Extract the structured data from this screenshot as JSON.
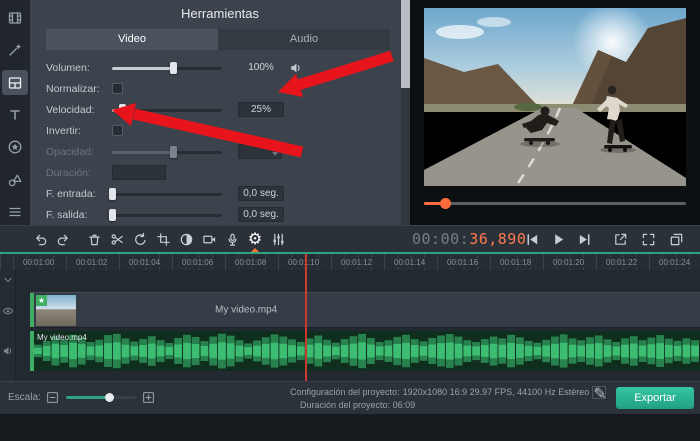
{
  "colors": {
    "accent_teal": "#2fbf9a",
    "accent_orange": "#ff7a45",
    "annotation_red": "#e8141b",
    "export_button": "#27b694",
    "playhead_red": "#c8392e"
  },
  "sidebar": {
    "items": [
      {
        "id": "media",
        "icon": "film-icon",
        "active": false
      },
      {
        "id": "filters",
        "icon": "wand-icon",
        "active": false
      },
      {
        "id": "tools",
        "icon": "panels-icon",
        "active": true
      },
      {
        "id": "titles",
        "icon": "titles-icon",
        "active": false
      },
      {
        "id": "stickers",
        "icon": "star-icon",
        "active": false
      },
      {
        "id": "callouts",
        "icon": "shapes-icon",
        "active": false
      },
      {
        "id": "more-tools",
        "icon": "list-icon",
        "active": false
      }
    ]
  },
  "tools_panel": {
    "title": "Herramientas",
    "tabs": [
      {
        "label": "Video",
        "active": true
      },
      {
        "label": "Audio",
        "active": false
      }
    ],
    "rows": [
      {
        "label": "Volumen:",
        "control": "slider",
        "fill": 55,
        "value": "100%",
        "boxed": false,
        "icon": "speaker-icon",
        "disabled": false
      },
      {
        "label": "Normalizar:",
        "control": "checkbox",
        "checked": false,
        "disabled": false
      },
      {
        "label": "Velocidad:",
        "control": "slider",
        "fill": 9,
        "value": "25%",
        "boxed": true,
        "disabled": false
      },
      {
        "label": "Invertir:",
        "control": "checkbox",
        "checked": false,
        "disabled": false
      },
      {
        "label": "Opacidad:",
        "control": "slider-spin",
        "fill": 55,
        "value": "",
        "disabled": true
      },
      {
        "label": "Duración:",
        "control": "input",
        "value": "",
        "disabled": true
      },
      {
        "label": "F. entrada:",
        "control": "slider",
        "fill": 0,
        "value": "0,0 seg.",
        "boxed": true,
        "disabled": false
      },
      {
        "label": "F. salida:",
        "control": "slider",
        "fill": 0,
        "value": "0,0 seg.",
        "boxed": true,
        "disabled": false
      }
    ]
  },
  "preview": {
    "seek_percent": 8
  },
  "transport": {
    "toolbar": [
      {
        "id": "undo",
        "icon": "undo-icon"
      },
      {
        "id": "redo",
        "icon": "redo-icon"
      },
      {
        "id": "delete",
        "icon": "trash-icon",
        "gap": true
      },
      {
        "id": "split",
        "icon": "scissors-icon"
      },
      {
        "id": "rotate",
        "icon": "rotate-icon"
      },
      {
        "id": "crop",
        "icon": "crop-icon"
      },
      {
        "id": "color-adjustments",
        "icon": "contrast-icon"
      },
      {
        "id": "capture",
        "icon": "camera-icon"
      },
      {
        "id": "voiceover",
        "icon": "microphone-icon"
      },
      {
        "id": "clip-properties",
        "icon": "gear-icon",
        "active": true
      },
      {
        "id": "audio-levels",
        "icon": "equalizer-icon"
      }
    ],
    "timecode": {
      "prefix": "00:00:",
      "current": "36,890"
    },
    "playback": [
      {
        "id": "previous-frame",
        "icon": "prev-icon"
      },
      {
        "id": "play",
        "icon": "play-icon"
      },
      {
        "id": "next-frame",
        "icon": "next-icon"
      }
    ],
    "right_buttons": [
      {
        "id": "share",
        "icon": "share-icon"
      },
      {
        "id": "fullscreen",
        "icon": "fullscreen-icon"
      },
      {
        "id": "detach-player",
        "icon": "detach-icon"
      }
    ]
  },
  "timeline": {
    "ruler_labels": [
      "00:01:00",
      "00:01:02",
      "00:01:04",
      "00:01:06",
      "00:01:08",
      "00:01:10",
      "00:01:12",
      "00:01:14",
      "00:01:16",
      "00:01:18",
      "00:01:20",
      "00:01:22",
      "00:01:24"
    ],
    "track_head_icons": [
      "chevron-down-icon",
      "eye-icon",
      "speaker-icon"
    ],
    "video_clip": {
      "label": "My video.mp4"
    },
    "audio_clip": {
      "label": "My video.mp4"
    },
    "waveform": [
      0.35,
      0.55,
      0.8,
      0.65,
      0.9,
      0.75,
      0.5,
      0.62,
      0.88,
      0.95,
      0.7,
      0.52,
      0.66,
      0.82,
      0.6,
      0.45,
      0.72,
      0.9,
      0.78,
      0.55,
      0.8,
      0.96,
      0.85,
      0.6,
      0.42,
      0.58,
      0.76,
      0.92,
      0.8,
      0.64,
      0.5,
      0.7,
      0.86,
      0.62,
      0.46,
      0.66,
      0.82,
      0.95,
      0.72,
      0.5,
      0.6,
      0.78,
      0.9,
      0.66,
      0.54,
      0.72,
      0.86,
      0.94,
      0.8,
      0.6,
      0.5,
      0.66,
      0.8,
      0.7,
      0.9,
      0.76,
      0.56,
      0.46,
      0.62,
      0.8,
      0.92,
      0.7,
      0.6,
      0.76,
      0.86,
      0.64,
      0.5,
      0.7,
      0.82,
      0.6,
      0.74,
      0.88,
      0.68,
      0.56,
      0.7,
      0.6
    ]
  },
  "statusbar": {
    "scale_label": "Escala:",
    "project_config_label": "Configuración del proyecto:",
    "project_config_value": "1920x1080 16:9 29.97 FPS, 44100 Hz Estéreo",
    "project_duration_label": "Duración del proyecto:",
    "project_duration_value": "06:09",
    "export_label": "Exportar"
  }
}
